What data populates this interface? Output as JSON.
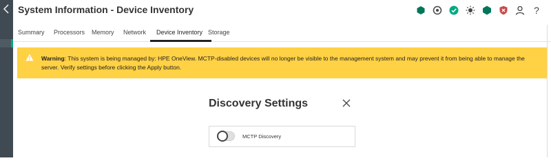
{
  "header": {
    "title": "System Information - Device Inventory"
  },
  "status_icons": [
    {
      "name": "health-status-icon",
      "color": "#00775a"
    },
    {
      "name": "uid-indicator-icon",
      "color": "#444444"
    },
    {
      "name": "ok-check-icon",
      "color": "#01a982"
    },
    {
      "name": "power-sun-icon",
      "color": "#444444"
    },
    {
      "name": "security-hex-icon",
      "color": "#00775a"
    },
    {
      "name": "shield-icon",
      "color": "#c54e4b"
    },
    {
      "name": "user-icon",
      "color": "#444444"
    },
    {
      "name": "help-icon",
      "color": "#444444"
    }
  ],
  "tabs": [
    {
      "label": "Summary"
    },
    {
      "label": "Processors"
    },
    {
      "label": "Memory"
    },
    {
      "label": "Network"
    },
    {
      "label": "Device Inventory",
      "active": true
    },
    {
      "label": "Storage"
    }
  ],
  "warning": {
    "label": "Warning",
    "message": ": This system is being managed by: HPE OneView. MCTP-disabled devices will no longer be visible to the management system and may prevent it from being able to manage the server. Verify settings before clicking the Apply button.",
    "color": "#ffd144"
  },
  "dialog": {
    "title": "Discovery Settings",
    "toggle_label": "MCTP Discovery",
    "toggle_on": false
  },
  "accent": "#01a982"
}
